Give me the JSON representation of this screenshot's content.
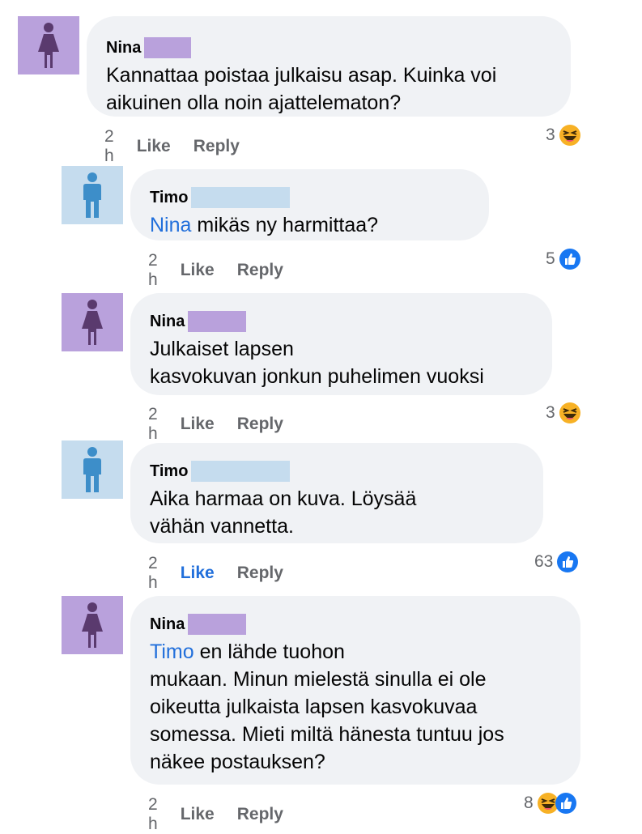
{
  "colors": {
    "female_avatar": "#b9a1dc",
    "male_avatar": "#c5dcee",
    "female_icon": "#5a3a6e",
    "male_icon": "#3d8ec9",
    "mention": "#216fdb",
    "bubble": "#f0f2f5",
    "meta": "#65676b"
  },
  "comments": [
    {
      "author": "Nina",
      "avatar": "female-user-icon",
      "text_parts": [
        {
          "mention": false,
          "text": "Kannattaa poistaa julkaisu asap. Kuinka voi aikuinen olla noin ajattelematon?"
        }
      ],
      "time": "2 h",
      "like": "Like",
      "reply": "Reply",
      "reaction_count": "3",
      "reactions": [
        "haha-icon"
      ]
    },
    {
      "author": "Timo",
      "avatar": "male-user-icon",
      "text_parts": [
        {
          "mention": true,
          "text": "Nina"
        },
        {
          "mention": false,
          "text": " mikäs ny harmittaa?"
        }
      ],
      "time": "2 h",
      "like": "Like",
      "reply": "Reply",
      "reaction_count": "5",
      "reactions": [
        "like-icon"
      ]
    },
    {
      "author": "Nina",
      "avatar": "female-user-icon",
      "text_parts": [
        {
          "mention": false,
          "text": "Julkaiset lapsen kasvokuvan jonkun puhelimen vuoksi"
        }
      ],
      "time": "2 h",
      "like": "Like",
      "reply": "Reply",
      "reaction_count": "3",
      "reactions": [
        "haha-icon"
      ]
    },
    {
      "author": "Timo",
      "avatar": "male-user-icon",
      "text_parts": [
        {
          "mention": false,
          "text": "Aika harmaa on kuva. Löysää vähän vannetta."
        }
      ],
      "time": "2 h",
      "like": "Like",
      "reply": "Reply",
      "reaction_count": "63",
      "reactions": [
        "like-icon"
      ],
      "liked": true
    },
    {
      "author": "Nina",
      "avatar": "female-user-icon",
      "text_parts": [
        {
          "mention": true,
          "text": "Timo"
        },
        {
          "mention": false,
          "text": " en lähde tuohon mukaan. Minun mielestä sinulla ei ole oikeutta julkaista lapsen kasvokuvaa somessa. Mieti miltä hänesta tuntuu jos näkee postauksen?"
        }
      ],
      "time": "2 h",
      "like": "Like",
      "reply": "Reply",
      "reaction_count": "8",
      "reactions": [
        "haha-icon",
        "like-icon"
      ]
    }
  ]
}
